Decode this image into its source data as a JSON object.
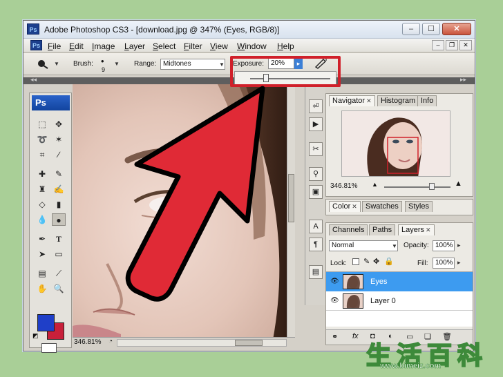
{
  "window": {
    "app_badge": "Ps",
    "title": "Adobe Photoshop CS3 - [download.jpg @ 347% (Eyes, RGB/8)]",
    "controls": [
      "–",
      "☐",
      "✕"
    ]
  },
  "menubar": {
    "items": [
      "File",
      "Edit",
      "Image",
      "Layer",
      "Select",
      "Filter",
      "View",
      "Window",
      "Help"
    ],
    "mdi_controls": [
      "–",
      "❐",
      "✕"
    ]
  },
  "options": {
    "brush_label": "Brush:",
    "brush_size": "9",
    "range_label": "Range:",
    "range_value": "Midtones",
    "exposure_label": "Exposure:",
    "exposure_value": "20%",
    "exposure_slider_fraction": 0.2
  },
  "toolbox": {
    "logo": "Ps"
  },
  "statusbar": {
    "zoom": "346.81%"
  },
  "navigator": {
    "tabs": [
      "Navigator",
      "Histogram",
      "Info"
    ],
    "zoom": "346.81%",
    "zoom_slider_fraction": 0.72
  },
  "color_panel": {
    "tabs": [
      "Color",
      "Swatches",
      "Styles"
    ]
  },
  "layers_panel": {
    "tabs": [
      "Channels",
      "Paths",
      "Layers"
    ],
    "blend_mode": "Normal",
    "opacity_label": "Opacity:",
    "opacity_value": "100%",
    "lock_label": "Lock:",
    "fill_label": "Fill:",
    "fill_value": "100%",
    "layers": [
      {
        "name": "Eyes",
        "selected": true
      },
      {
        "name": "Layer 0",
        "selected": false
      }
    ]
  },
  "watermark": {
    "chars": "生活百科",
    "url": "www.bimeiz.com"
  },
  "colors": {
    "foreground": "#1f3fc8",
    "background": "#c8203a",
    "highlight": "#d0202a",
    "layer_selected": "#3d9bf0"
  }
}
